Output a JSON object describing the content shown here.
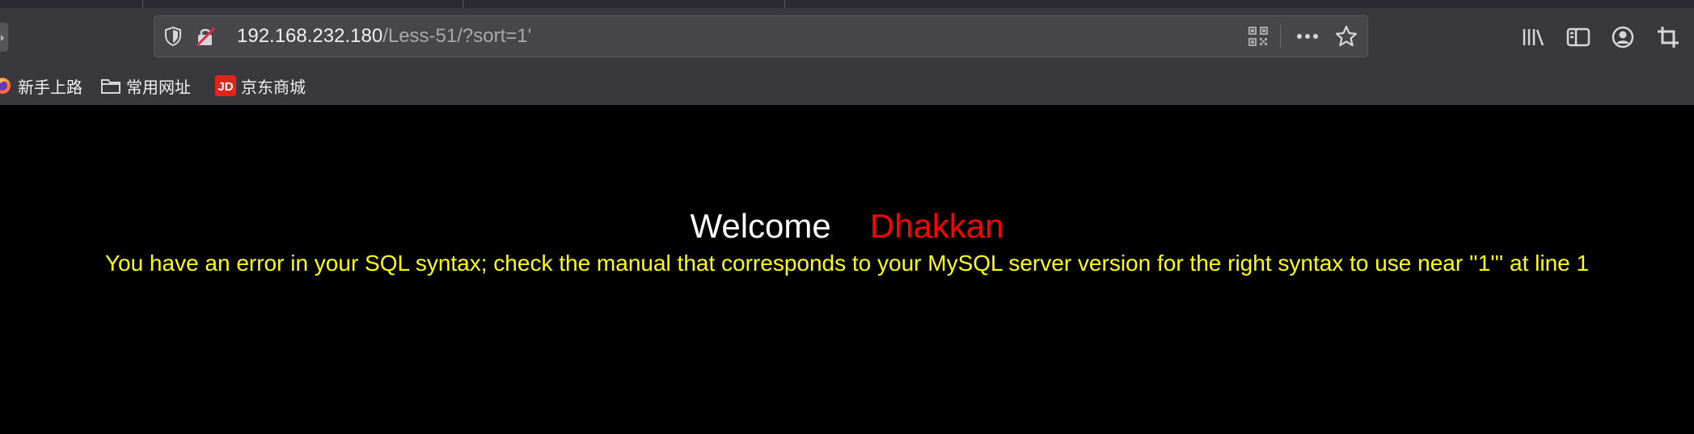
{
  "browser": {
    "address_bar": {
      "host": "192.168.232.180",
      "path": "/Less-51/?sort=1'"
    },
    "icons": {
      "tracking_protection": "shield-icon",
      "insecure_connection": "insecure-lock-icon",
      "qr_code": "qr-code-icon",
      "page_actions": "more-icon",
      "bookmark_star": "star-icon",
      "library": "library-icon",
      "sidebar": "sidebar-icon",
      "account": "account-icon",
      "screenshot": "screenshot-icon"
    }
  },
  "bookmarks": [
    {
      "label": "新手上路",
      "icon": "firefox-icon"
    },
    {
      "label": "常用网址",
      "icon": "folder-icon"
    },
    {
      "label": "京东商城",
      "icon": "jd-icon"
    }
  ],
  "page": {
    "welcome": "Welcome",
    "user_name": "Dhakkan",
    "error_message": "You have an error in your SQL syntax; check the manual that corresponds to your MySQL server version for the right syntax to use near ''1''' at line 1",
    "colors": {
      "background": "#000000",
      "welcome": "#ffffff",
      "user_name": "#ff0000",
      "error": "#ffff00"
    }
  }
}
